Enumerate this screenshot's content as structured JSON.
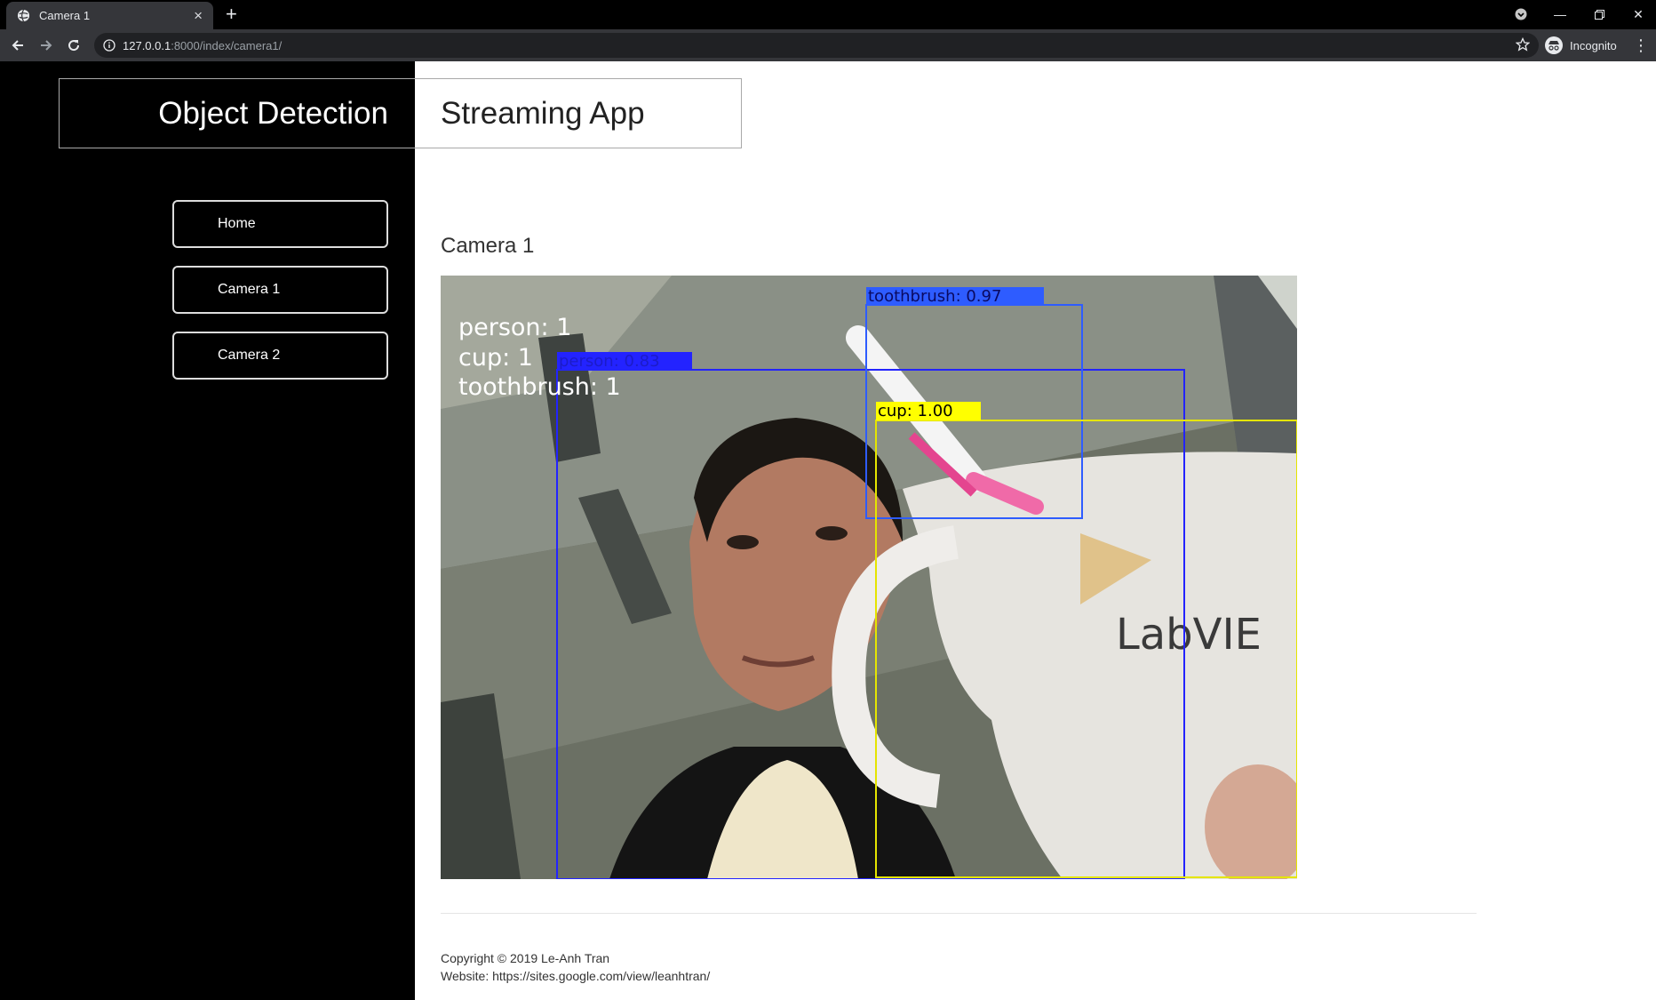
{
  "browser": {
    "tab_title": "Camera 1",
    "url_host": "127.0.0.1",
    "url_rest": ":8000/index/camera1/",
    "incognito_label": "Incognito"
  },
  "brand": {
    "left": "Object Detection",
    "right": "Streaming App"
  },
  "nav": {
    "items": [
      {
        "label": "Home"
      },
      {
        "label": "Camera 1"
      },
      {
        "label": "Camera 2"
      }
    ]
  },
  "main": {
    "camera_title": "Camera 1"
  },
  "stream": {
    "counts": [
      "person:  1",
      "cup:  1",
      "toothbrush:  1"
    ],
    "detections": [
      {
        "label": "person: 0.83",
        "color": "#2323ff"
      },
      {
        "label": "toothbrush: 0.97",
        "color": "#2e5cff"
      },
      {
        "label": "cup: 1.00",
        "color": "#ffff00"
      }
    ],
    "mug_text": "LabVIE"
  },
  "footer": {
    "copyright": "Copyright © 2019 Le-Anh Tran",
    "website": "Website: https://sites.google.com/view/leanhtran/"
  }
}
